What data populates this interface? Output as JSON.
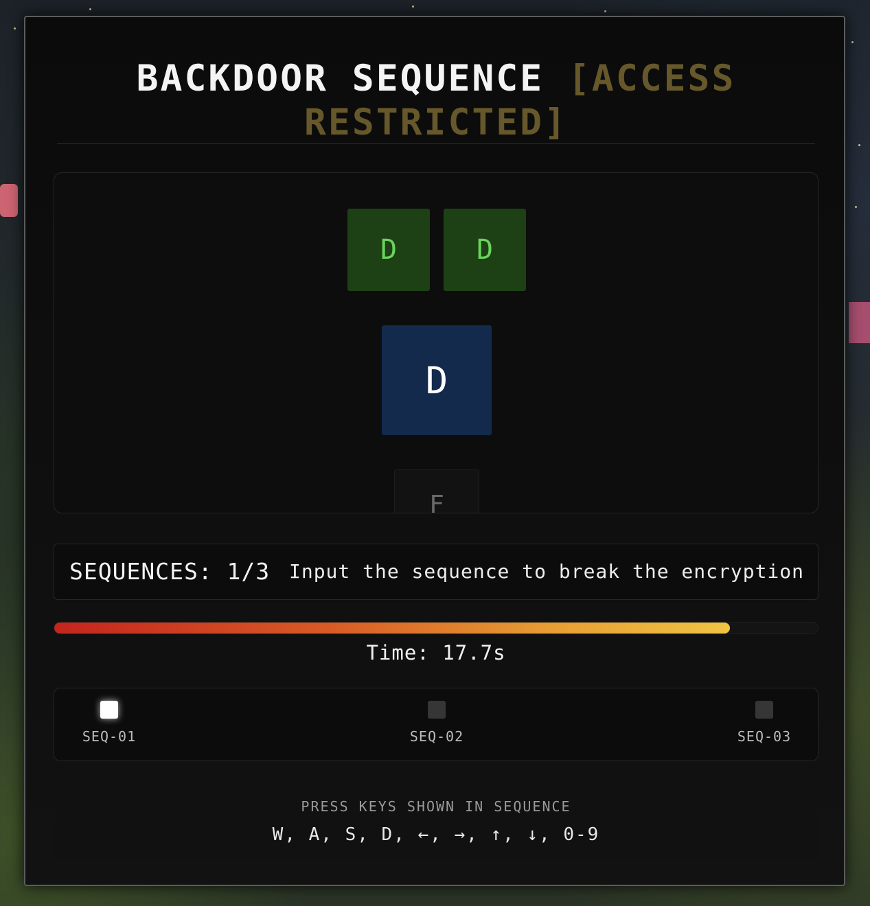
{
  "title": {
    "main": "BACKDOOR SEQUENCE",
    "restricted": "[ACCESS RESTRICTED]"
  },
  "sequence": {
    "completed_keys": [
      "D",
      "D"
    ],
    "current_key": "D",
    "next_key": "F"
  },
  "status": {
    "sequences_label": "SEQUENCES: 1/3",
    "instruction": "Input the sequence to break the encryption"
  },
  "timer": {
    "remaining_fraction": 0.885,
    "label": "Time: 17.7s"
  },
  "progress": {
    "steps": [
      {
        "label": "SEQ-01",
        "active": true
      },
      {
        "label": "SEQ-02",
        "active": false
      },
      {
        "label": "SEQ-03",
        "active": false
      }
    ]
  },
  "help": {
    "title": "PRESS KEYS SHOWN IN SEQUENCE",
    "keys": "W, A, S, D, ←, →, ↑, ↓, 0-9"
  },
  "colors": {
    "done_key_bg": "#1e4015",
    "current_key_bg": "#132a4d",
    "restricted_text": "#66582a",
    "timer_start": "#c4251d",
    "timer_end": "#f0c444"
  }
}
